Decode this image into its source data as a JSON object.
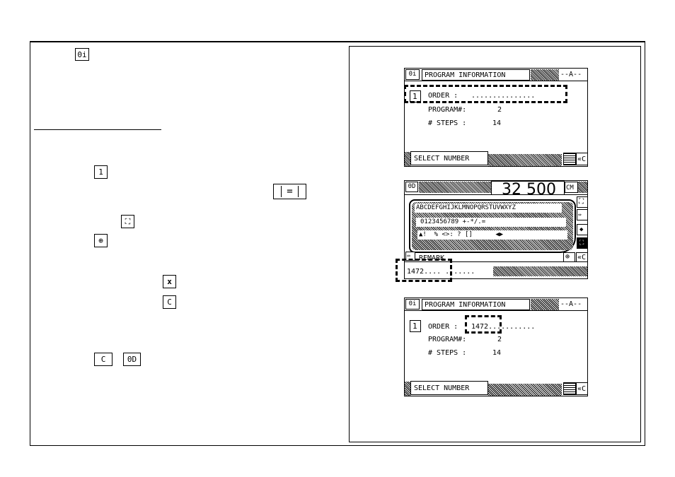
{
  "keys": {
    "info_key": "0i",
    "one_key": "1",
    "equal_key": "=",
    "select_all_key": "⛶",
    "enter_key": "⊕",
    "delete_key": "x",
    "clear_key": "C",
    "clear_key_2": "C",
    "od_key": "0D"
  },
  "screen1": {
    "corner_icon": "0i",
    "title": "PROGRAM INFORMATION",
    "mode": "--A--",
    "field_number": "1",
    "order_label": "ORDER :",
    "order_value": "...............",
    "program_label": "PROGRAM#:",
    "program_value": "2",
    "steps_label": "# STEPS :",
    "steps_value": "14",
    "select_button": "SELECT NUMBER",
    "back_icon": "«C"
  },
  "screen2": {
    "corner_icon": "0D",
    "readout": "32 500",
    "unit": "CM",
    "row_letters": "ABCDEFGHIJKLMNOPQRSTUVWXYZ",
    "row_numbers": "0123456789 +-*/.=",
    "row_symbols": "▲!  % <>: ? []      ◀▶",
    "remark_label": "REMARK",
    "input_value": "1472.... .......",
    "side_icon_2": "⇔",
    "back_icon": "«C"
  },
  "screen3": {
    "corner_icon": "0i",
    "title": "PROGRAM INFORMATION",
    "mode": "--A--",
    "field_number": "1",
    "order_label": "ORDER :",
    "order_value": "1472...........",
    "program_label": "PROGRAM#:",
    "program_value": "2",
    "steps_label": "# STEPS :",
    "steps_value": "14",
    "select_button": "SELECT NUMBER",
    "back_icon": "«C"
  }
}
